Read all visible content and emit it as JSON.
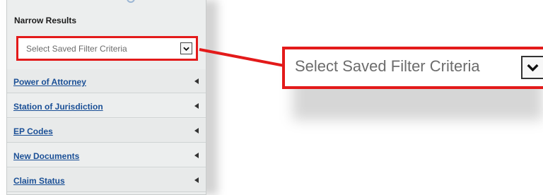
{
  "panel": {
    "title": "Narrow Results",
    "saved_filter": {
      "placeholder": "Select Saved Filter Criteria"
    },
    "filters": [
      {
        "label": "Power of Attorney"
      },
      {
        "label": "Station of Jurisdiction"
      },
      {
        "label": "EP Codes"
      },
      {
        "label": "New Documents"
      },
      {
        "label": "Claim Status"
      }
    ]
  },
  "callout": {
    "text": "Select Saved Filter Criteria",
    "highlight_color": "#e31a1a"
  },
  "colors": {
    "link": "#1a4f96",
    "panel_bg": "#eceeee",
    "highlight": "#e31a1a"
  }
}
